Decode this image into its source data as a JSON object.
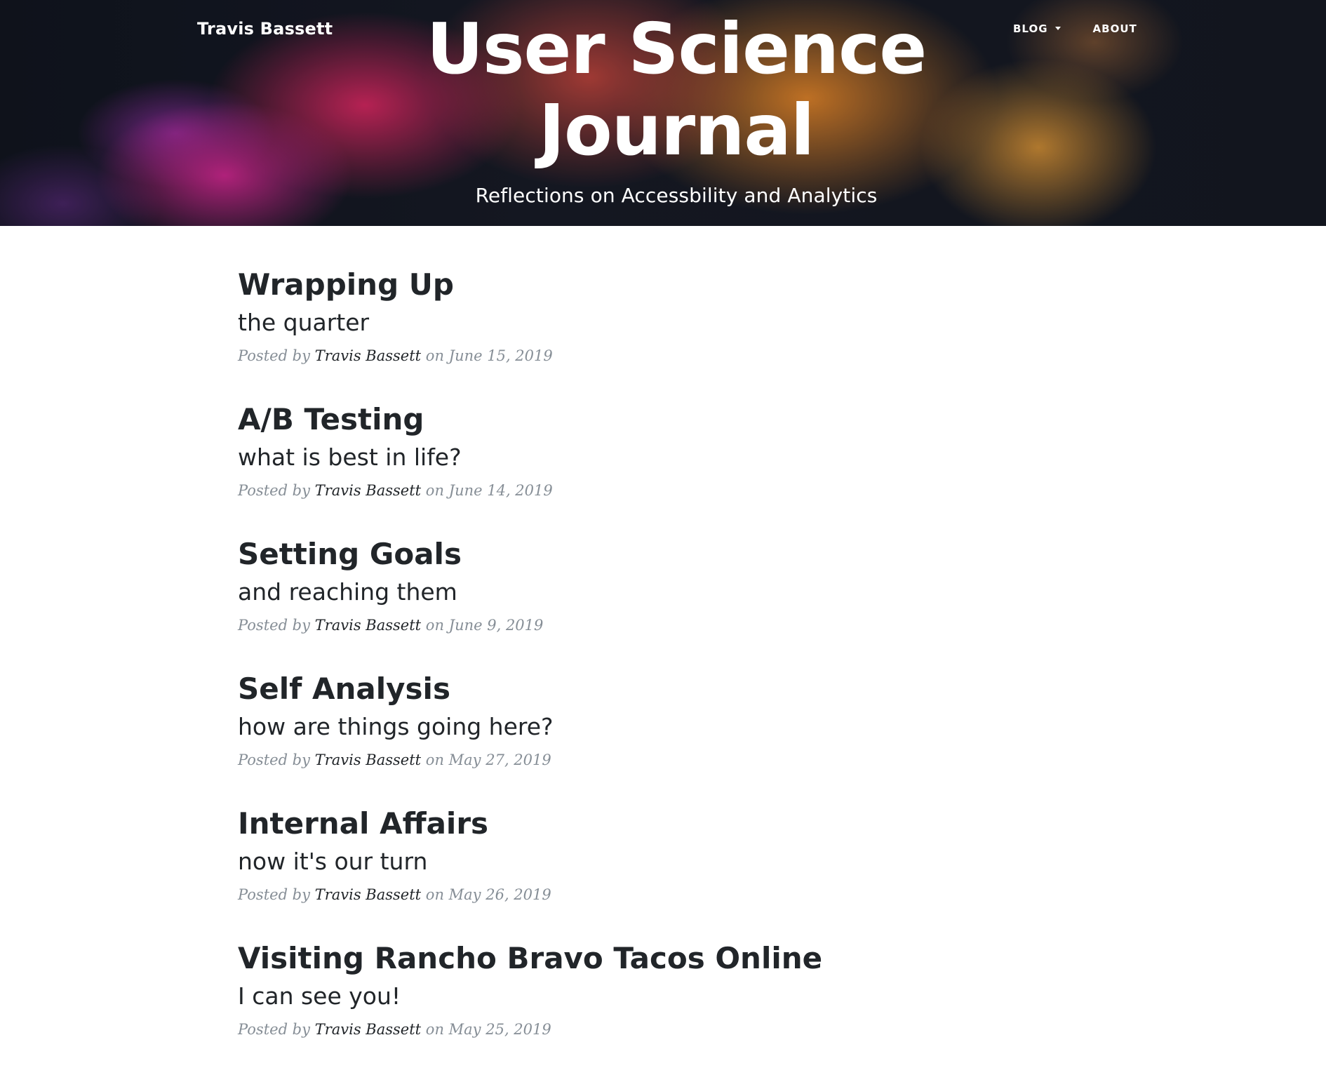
{
  "navbar": {
    "brand": "Travis Bassett",
    "links": [
      {
        "label": "BLOG",
        "has_dropdown": true
      },
      {
        "label": "ABOUT",
        "has_dropdown": false
      }
    ]
  },
  "header": {
    "title_line1": "User Science",
    "title_line2": "Journal",
    "subtitle": "Reflections on Accessbility and Analytics"
  },
  "posts": [
    {
      "title": "Wrapping Up",
      "subtitle": "the quarter",
      "posted_by": "Posted by",
      "author": "Travis Bassett",
      "on": "on",
      "date": "June 15, 2019"
    },
    {
      "title": "A/B Testing",
      "subtitle": "what is best in life?",
      "posted_by": "Posted by",
      "author": "Travis Bassett",
      "on": "on",
      "date": "June 14, 2019"
    },
    {
      "title": "Setting Goals",
      "subtitle": "and reaching them",
      "posted_by": "Posted by",
      "author": "Travis Bassett",
      "on": "on",
      "date": "June 9, 2019"
    },
    {
      "title": "Self Analysis",
      "subtitle": "how are things going here?",
      "posted_by": "Posted by",
      "author": "Travis Bassett",
      "on": "on",
      "date": "May 27, 2019"
    },
    {
      "title": "Internal Affairs",
      "subtitle": "now it's our turn",
      "posted_by": "Posted by",
      "author": "Travis Bassett",
      "on": "on",
      "date": "May 26, 2019"
    },
    {
      "title": "Visiting Rancho Bravo Tacos Online",
      "subtitle": "I can see you!",
      "posted_by": "Posted by",
      "author": "Travis Bassett",
      "on": "on",
      "date": "May 25, 2019"
    }
  ],
  "colors": {
    "text": "#212529",
    "meta": "#868e96",
    "nav_text": "#ffffff"
  }
}
